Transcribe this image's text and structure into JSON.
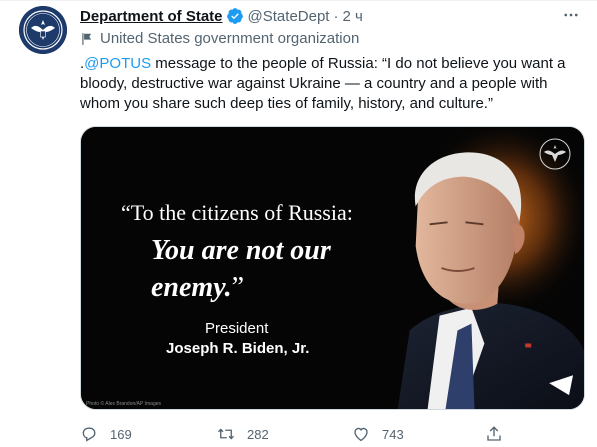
{
  "tweet": {
    "display_name": "Department of State",
    "handle": "@StateDept",
    "dot": "·",
    "time": "2 ч",
    "gov_label": "United States government organization",
    "text_prefix": ".",
    "mention": "@POTUS",
    "text_body": " message to the people of Russia: “I do not believe you want a bloody, destructive war against Ukraine — a country and a people with whom you share such deep ties of family, history, and culture.”"
  },
  "media": {
    "quote_open": "“To the citizens of Russia:",
    "quote_main": "You are not our enemy.",
    "quote_close": "”",
    "title": "President",
    "signature": "Joseph R. Biden, Jr.",
    "credit": "Photo © Alex Brandon/AP Images"
  },
  "actions": {
    "replies": "169",
    "retweets": "282",
    "likes": "743"
  },
  "icons": {
    "verified": "verified-badge-icon",
    "more": "more-icon",
    "gov_label": "flag-icon",
    "reply": "reply-icon",
    "retweet": "retweet-icon",
    "like": "heart-icon",
    "share": "share-icon"
  },
  "colors": {
    "accent": "#1d9bf0",
    "muted": "#536471",
    "text": "#0f1419",
    "seal_blue": "#1d3a6b"
  }
}
